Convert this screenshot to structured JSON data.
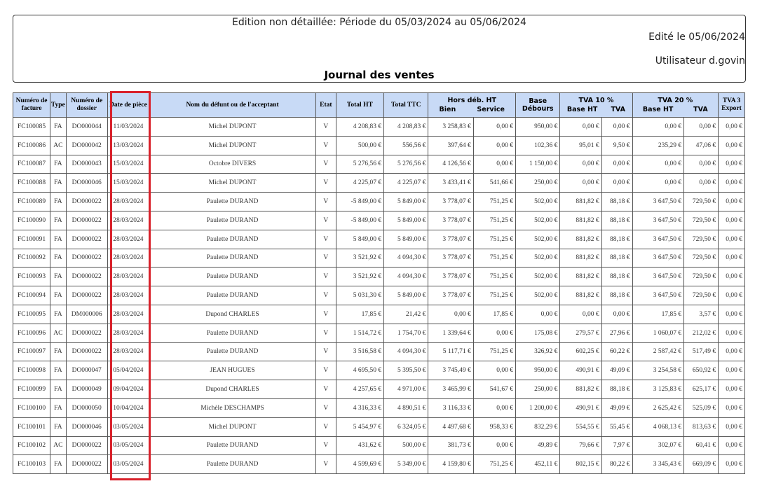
{
  "header": {
    "edition_title": "Edition non détaillée: Période du 05/03/2024 au 05/06/2024",
    "edited_date": "Edité le 05/06/2024",
    "user": "Utilisateur d.govin",
    "journal_title": "Journal des ventes"
  },
  "columns": {
    "num_facture": "Numéro de facture",
    "type": "Type",
    "num_dossier": "Numéro de dossier",
    "date_piece": "Date de pièce",
    "nom": "Nom du défunt ou de l'acceptant",
    "etat": "Etat",
    "total_ht": "Total HT",
    "total_ttc": "Total TTC",
    "hors_deb": "Hors déb. HT",
    "hors_deb_bien": "Bien",
    "hors_deb_service": "Service",
    "base_debours": "Base Débours",
    "tva10": "TVA 10 %",
    "tva10_base": "Base HT",
    "tva10_tva": "TVA",
    "tva20": "TVA 20 %",
    "tva20_base": "Base HT",
    "tva20_tva": "TVA",
    "tva3": "TVA 3 Export"
  },
  "rows": [
    [
      "FC100085",
      "FA",
      "DO000044",
      "11/03/2024",
      "Michel DUPONT",
      "V",
      "4 208,83 €",
      "4 208,83 €",
      "3 258,83 €",
      "0,00 €",
      "950,00 €",
      "0,00 €",
      "0,00 €",
      "0,00 €",
      "0,00 €",
      "0,00 €"
    ],
    [
      "FC100086",
      "AC",
      "DO000042",
      "13/03/2024",
      "Michel DUPONT",
      "V",
      "500,00 €",
      "556,56 €",
      "397,64 €",
      "0,00 €",
      "102,36 €",
      "95,01 €",
      "9,50 €",
      "235,29 €",
      "47,06 €",
      "0,00 €"
    ],
    [
      "FC100087",
      "FA",
      "DO000043",
      "15/03/2024",
      "Octobre DIVERS",
      "V",
      "5 276,56 €",
      "5 276,56 €",
      "4 126,56 €",
      "0,00 €",
      "1 150,00 €",
      "0,00 €",
      "0,00 €",
      "0,00 €",
      "0,00 €",
      "0,00 €"
    ],
    [
      "FC100088",
      "FA",
      "DO000046",
      "15/03/2024",
      "Michel DUPONT",
      "V",
      "4 225,07 €",
      "4 225,07 €",
      "3 433,41 €",
      "541,66 €",
      "250,00 €",
      "0,00 €",
      "0,00 €",
      "0,00 €",
      "0,00 €",
      "0,00 €"
    ],
    [
      "FC100089",
      "FA",
      "DO000022",
      "28/03/2024",
      "Paulette DURAND",
      "V",
      "-5 849,00 €",
      "5 849,00 €",
      "3 778,07 €",
      "751,25 €",
      "502,00 €",
      "881,82 €",
      "88,18 €",
      "3 647,50 €",
      "729,50 €",
      "0,00 €"
    ],
    [
      "FC100090",
      "FA",
      "DO000022",
      "28/03/2024",
      "Paulette DURAND",
      "V",
      "-5 849,00 €",
      "5 849,00 €",
      "3 778,07 €",
      "751,25 €",
      "502,00 €",
      "881,82 €",
      "88,18 €",
      "3 647,50 €",
      "729,50 €",
      "0,00 €"
    ],
    [
      "FC100091",
      "FA",
      "DO000022",
      "28/03/2024",
      "Paulette DURAND",
      "V",
      "5 849,00 €",
      "5 849,00 €",
      "3 778,07 €",
      "751,25 €",
      "502,00 €",
      "881,82 €",
      "88,18 €",
      "3 647,50 €",
      "729,50 €",
      "0,00 €"
    ],
    [
      "FC100092",
      "FA",
      "DO000022",
      "28/03/2024",
      "Paulette DURAND",
      "V",
      "3 521,92 €",
      "4 094,30 €",
      "3 778,07 €",
      "751,25 €",
      "502,00 €",
      "881,82 €",
      "88,18 €",
      "3 647,50 €",
      "729,50 €",
      "0,00 €"
    ],
    [
      "FC100093",
      "FA",
      "DO000022",
      "28/03/2024",
      "Paulette DURAND",
      "V",
      "3 521,92 €",
      "4 094,30 €",
      "3 778,07 €",
      "751,25 €",
      "502,00 €",
      "881,82 €",
      "88,18 €",
      "3 647,50 €",
      "729,50 €",
      "0,00 €"
    ],
    [
      "FC100094",
      "FA",
      "DO000022",
      "28/03/2024",
      "Paulette DURAND",
      "V",
      "5 031,30 €",
      "5 849,00 €",
      "3 778,07 €",
      "751,25 €",
      "502,00 €",
      "881,82 €",
      "88,18 €",
      "3 647,50 €",
      "729,50 €",
      "0,00 €"
    ],
    [
      "FC100095",
      "FA",
      "DM000006",
      "28/03/2024",
      "Dupond CHARLES",
      "V",
      "17,85 €",
      "21,42 €",
      "0,00 €",
      "17,85 €",
      "0,00 €",
      "0,00 €",
      "0,00 €",
      "17,85 €",
      "3,57 €",
      "0,00 €"
    ],
    [
      "FC100096",
      "AC",
      "DO000022",
      "28/03/2024",
      "Paulette DURAND",
      "V",
      "1 514,72 €",
      "1 754,70 €",
      "1 339,64 €",
      "0,00 €",
      "175,08 €",
      "279,57 €",
      "27,96 €",
      "1 060,07 €",
      "212,02 €",
      "0,00 €"
    ],
    [
      "FC100097",
      "FA",
      "DO000022",
      "28/03/2024",
      "Paulette DURAND",
      "V",
      "3 516,58 €",
      "4 094,30 €",
      "5 117,71 €",
      "751,25 €",
      "326,92 €",
      "602,25 €",
      "60,22 €",
      "2 587,42 €",
      "517,49 €",
      "0,00 €"
    ],
    [
      "FC100098",
      "FA",
      "DO000047",
      "05/04/2024",
      "JEAN HUGUES",
      "V",
      "4 695,50 €",
      "5 395,50 €",
      "3 745,49 €",
      "0,00 €",
      "950,00 €",
      "490,91 €",
      "49,09 €",
      "3 254,58 €",
      "650,92 €",
      "0,00 €"
    ],
    [
      "FC100099",
      "FA",
      "DO000049",
      "09/04/2024",
      "Dupond CHARLES",
      "V",
      "4 257,65 €",
      "4 971,00 €",
      "3 465,99 €",
      "541,67 €",
      "250,00 €",
      "881,82 €",
      "88,18 €",
      "3 125,83 €",
      "625,17 €",
      "0,00 €"
    ],
    [
      "FC100100",
      "FA",
      "DO000050",
      "10/04/2024",
      "Michèle DESCHAMPS",
      "V",
      "4 316,33 €",
      "4 890,51 €",
      "3 116,33 €",
      "0,00 €",
      "1 200,00 €",
      "490,91 €",
      "49,09 €",
      "2 625,42 €",
      "525,09 €",
      "0,00 €"
    ],
    [
      "FC100101",
      "FA",
      "DO000046",
      "03/05/2024",
      "Michel DUPONT",
      "V",
      "5 454,97 €",
      "6 324,05 €",
      "4 497,68 €",
      "958,33 €",
      "832,29 €",
      "554,55 €",
      "55,45 €",
      "4 068,13 €",
      "813,63 €",
      "0,00 €"
    ],
    [
      "FC100102",
      "AC",
      "DO000022",
      "03/05/2024",
      "Paulette DURAND",
      "V",
      "431,62 €",
      "500,00 €",
      "381,73 €",
      "0,00 €",
      "49,89 €",
      "79,66 €",
      "7,97 €",
      "302,07 €",
      "60,41 €",
      "0,00 €"
    ],
    [
      "FC100103",
      "FA",
      "DO000022",
      "03/05/2024",
      "Paulette DURAND",
      "V",
      "4 599,69 €",
      "5 349,00 €",
      "4 159,80 €",
      "751,25 €",
      "452,11 €",
      "802,15 €",
      "80,22 €",
      "3 345,43 €",
      "669,09 €",
      "0,00 €"
    ]
  ],
  "colors": {
    "header_bg": "#c8daf6",
    "highlight": "#d9212b"
  }
}
